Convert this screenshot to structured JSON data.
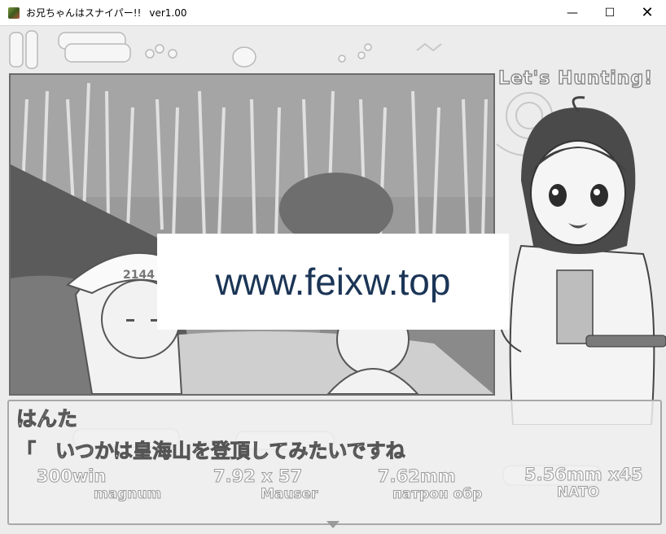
{
  "window": {
    "title": "お兄ちゃんはスナイパー!!",
    "version": "ver1.00",
    "minimize_glyph": "—",
    "maximize_glyph": "☐",
    "close_glyph": "✕"
  },
  "banner": {
    "text": "Let's Hunting!"
  },
  "watermark": {
    "text": "www.feixw.top"
  },
  "message": {
    "speaker": "はんた",
    "text": "「　いつかは皇海山を登頂してみたいですね"
  },
  "ammo_labels": [
    {
      "line1": "300win",
      "line2": "magnum"
    },
    {
      "line1": "7.92 x 57",
      "line2": "Mauser"
    },
    {
      "line1": "7.62mm",
      "line2": "патрон обр"
    },
    {
      "line1": "5.56mm x45",
      "line2": "NATO"
    }
  ],
  "scene": {
    "cap_text": "2144"
  },
  "icons": [
    "app-icon",
    "continue-arrow-icon"
  ]
}
